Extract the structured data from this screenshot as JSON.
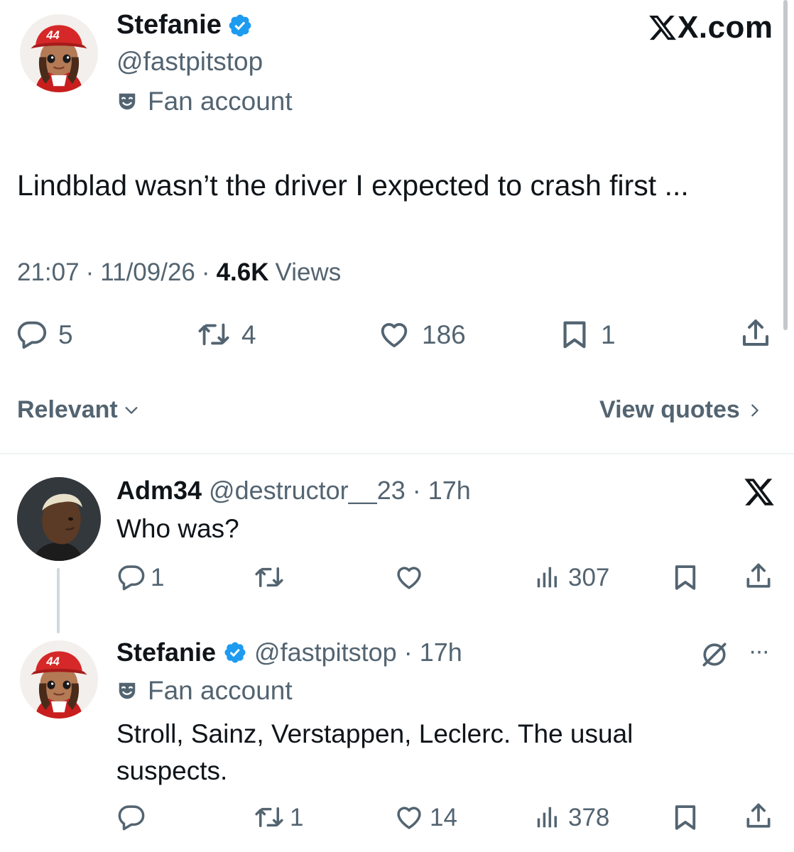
{
  "brand": {
    "site": "X.com",
    "x_glyph": "X"
  },
  "main_tweet": {
    "name": "Stefanie",
    "handle": "@fastpitstop",
    "badge": "Fan account",
    "avatar_number": "44",
    "text": "Lindblad wasn’t the driver I expected to crash first ...",
    "time": "21:07",
    "date": "11/09/26",
    "views_count": "4.6K",
    "views_label": "Views",
    "sep": "·",
    "actions": {
      "replies": "5",
      "reposts": "4",
      "likes": "186",
      "bookmarks": "1"
    }
  },
  "filter": {
    "sort_label": "Relevant",
    "quotes_label": "View quotes"
  },
  "replies": [
    {
      "name": "Adm34",
      "handle": "@destructor__23",
      "sep": "·",
      "time": "17h",
      "text": "Who was?",
      "actions": {
        "replies": "1",
        "reposts": "",
        "likes": "",
        "views": "307"
      }
    },
    {
      "name": "Stefanie",
      "handle": "@fastpitstop",
      "sep": "·",
      "time": "17h",
      "badge": "Fan account",
      "avatar_number": "44",
      "text_line1": "Stroll, Sainz, Verstappen, Leclerc. The usual",
      "text_line2": "suspects.",
      "more": "···",
      "actions": {
        "replies": "",
        "reposts": "1",
        "likes": "14",
        "views": "378"
      }
    }
  ],
  "colors": {
    "verified": "#1d9bf0",
    "text": "#0f1419",
    "secondary": "#536471",
    "divider": "#eff3f4",
    "avatar_red": "#d62828"
  },
  "icons": [
    "verified-badge-icon",
    "theater-mask-icon",
    "reply-icon",
    "repost-icon",
    "like-icon",
    "bookmark-icon",
    "share-icon",
    "views-icon",
    "chevron-down-icon",
    "chevron-right-icon",
    "x-logo-icon",
    "grok-slash-icon",
    "more-icon"
  ]
}
